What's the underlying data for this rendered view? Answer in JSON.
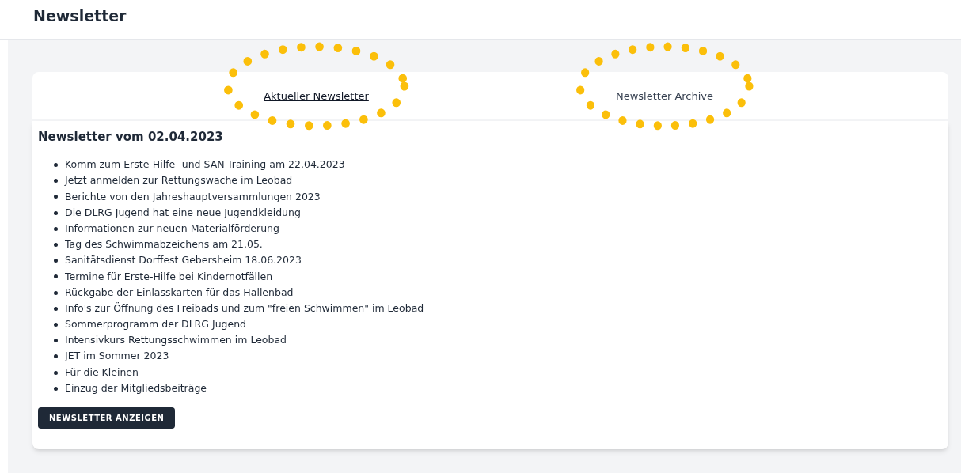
{
  "page_title": "Newsletter",
  "tabs": [
    {
      "label": "Aktueller Newsletter",
      "selected": true,
      "circled": true
    },
    {
      "label": "Newsletter Archive",
      "selected": false,
      "circled": true
    }
  ],
  "newsletter": {
    "heading": "Newsletter vom 02.04.2023",
    "items": [
      "Komm zum Erste-Hilfe- und SAN-Training am 22.04.2023",
      "Jetzt anmelden zur Rettungswache im Leobad",
      "Berichte von den Jahreshauptversammlungen 2023",
      "Die DLRG Jugend hat eine neue Jugendkleidung",
      "Informationen zur neuen Materialförderung",
      "Tag des Schwimmabzeichens am 21.05.",
      "Sanitätsdienst Dorffest Gebersheim 18.06.2023",
      "Termine für Erste-Hilfe bei Kindernotfällen",
      "Rückgabe der Einlasskarten für das Hallenbad",
      "Info's zur Öffnung des Freibads und zum \"freien Schwimmen\" im Leobad",
      "Sommerprogramm der DLRG Jugend",
      "Intensivkurs Rettungsschwimmen im Leobad",
      "JET im Sommer 2023",
      "Für die Kleinen",
      "Einzug der Mitgliedsbeiträge"
    ],
    "button": "NEWSLETTER ANZEIGEN"
  }
}
